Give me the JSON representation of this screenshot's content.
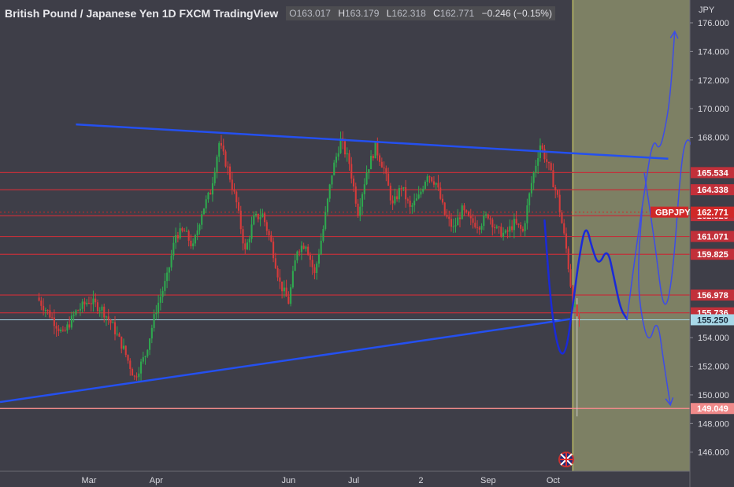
{
  "header": {
    "title": "British Pound / Japanese Yen  1D  FXCM  TradingView",
    "o_label": "O",
    "o": "163.017",
    "h_label": "H",
    "h": "163.179",
    "l_label": "L",
    "l": "162.318",
    "c_label": "C",
    "c": "162.771",
    "change": "−0.246 (−0.15%)"
  },
  "colors": {
    "background": "#3e3e48",
    "future_zone": "#7d8064",
    "up_candle": "#2fa84f",
    "down_candle": "#d63b3b",
    "level_line": "#c2303a",
    "trendline": "#2450f0",
    "drawing": "#3d4ce6",
    "cursor_line": "#e4e46a",
    "support_tag": "#a8d8e8",
    "low_tag": "#f08a8a",
    "symbol_tag": "#d02828"
  },
  "chart_data": {
    "type": "candlestick",
    "symbol": "GBPJPY",
    "currency_label": "JPY",
    "ylim": [
      146,
      178
    ],
    "y_ticks": [
      "176.000",
      "174.000",
      "172.000",
      "170.000",
      "168.000",
      "154.000",
      "152.000",
      "150.000",
      "148.000",
      "146.000"
    ],
    "x_ticks": [
      {
        "label": "Mar",
        "day": 23
      },
      {
        "label": "Apr",
        "day": 54
      },
      {
        "label": "Jun",
        "day": 115
      },
      {
        "label": "Jul",
        "day": 145
      },
      {
        "label": "2",
        "day": 176
      },
      {
        "label": "Sep",
        "day": 207
      },
      {
        "label": "Oct",
        "day": 237
      }
    ],
    "x_range": [
      -18,
      300
    ],
    "last_day": 249,
    "future_start_day": 246,
    "levels": [
      {
        "price": 165.534,
        "label": "165.534"
      },
      {
        "price": 164.338,
        "label": "164.338"
      },
      {
        "price": 162.526,
        "label": "162.526"
      },
      {
        "price": 161.071,
        "label": "161.071"
      },
      {
        "price": 159.825,
        "label": "159.825"
      },
      {
        "price": 156.978,
        "label": "156.978"
      },
      {
        "price": 155.736,
        "label": "155.736"
      }
    ],
    "current_price": {
      "price": 162.771,
      "label": "162.771",
      "symbol": "GBPJPY"
    },
    "support_price": {
      "price": 155.25,
      "label": "155.250"
    },
    "low_price": {
      "price": 149.049,
      "label": "149.049"
    },
    "trendlines": [
      {
        "from": [
          17,
          168.9
        ],
        "to": [
          290,
          166.5
        ]
      },
      {
        "from": [
          -18,
          149.5
        ],
        "to": [
          245,
          155.3
        ]
      }
    ],
    "price_path": [
      [
        0,
        156.8
      ],
      [
        6,
        155.6
      ],
      [
        12,
        154.2
      ],
      [
        18,
        155.8
      ],
      [
        24,
        156.6
      ],
      [
        30,
        156.0
      ],
      [
        35,
        154.8
      ],
      [
        40,
        153.2
      ],
      [
        45,
        151.2
      ],
      [
        50,
        152.8
      ],
      [
        55,
        156.0
      ],
      [
        60,
        158.2
      ],
      [
        64,
        161.2
      ],
      [
        68,
        161.4
      ],
      [
        72,
        160.3
      ],
      [
        76,
        162.8
      ],
      [
        80,
        164.2
      ],
      [
        84,
        167.6
      ],
      [
        88,
        165.8
      ],
      [
        92,
        163.4
      ],
      [
        96,
        160.0
      ],
      [
        100,
        162.3
      ],
      [
        104,
        162.6
      ],
      [
        108,
        160.6
      ],
      [
        112,
        157.8
      ],
      [
        116,
        156.5
      ],
      [
        120,
        160.2
      ],
      [
        124,
        160.6
      ],
      [
        128,
        158.4
      ],
      [
        132,
        161.6
      ],
      [
        136,
        165.5
      ],
      [
        140,
        167.8
      ],
      [
        144,
        166.2
      ],
      [
        148,
        162.8
      ],
      [
        152,
        165.6
      ],
      [
        156,
        167.3
      ],
      [
        160,
        165.8
      ],
      [
        164,
        163.2
      ],
      [
        168,
        164.6
      ],
      [
        172,
        163.0
      ],
      [
        176,
        163.8
      ],
      [
        180,
        165.5
      ],
      [
        184,
        164.8
      ],
      [
        188,
        162.6
      ],
      [
        192,
        161.6
      ],
      [
        196,
        162.9
      ],
      [
        200,
        162.1
      ],
      [
        204,
        161.9
      ],
      [
        208,
        162.6
      ],
      [
        212,
        161.5
      ],
      [
        216,
        161.2
      ],
      [
        220,
        162.0
      ],
      [
        224,
        161.4
      ],
      [
        228,
        164.8
      ],
      [
        232,
        167.5
      ],
      [
        236,
        165.9
      ],
      [
        240,
        163.8
      ],
      [
        244,
        160.2
      ],
      [
        247,
        156.5
      ],
      [
        250,
        155.0
      ],
      [
        253,
        158.2
      ],
      [
        256,
        162.0
      ],
      [
        259,
        165.2
      ],
      [
        262,
        163.6
      ],
      [
        265,
        161.6
      ],
      [
        268,
        160.9
      ],
      [
        271,
        162.9
      ],
      [
        274,
        162.771
      ]
    ]
  },
  "drawings": {
    "blue_path": [
      [
        233,
        162.2
      ],
      [
        235,
        158.0
      ],
      [
        237,
        155.0
      ],
      [
        240,
        152.8
      ],
      [
        243,
        153.0
      ],
      [
        246,
        156.2
      ],
      [
        249,
        159.7
      ],
      [
        252,
        162.0
      ],
      [
        255,
        160.2
      ],
      [
        258,
        159.0
      ],
      [
        262,
        160.3
      ],
      [
        265,
        158.2
      ],
      [
        268,
        156.0
      ],
      [
        271,
        155.3
      ]
    ],
    "arrow_up_1": [
      [
        271,
        155.3
      ],
      [
        275,
        160.0
      ],
      [
        279,
        164.2
      ],
      [
        283,
        168.0
      ],
      [
        286,
        167.0
      ],
      [
        289,
        168.9
      ],
      [
        291,
        171.0
      ],
      [
        293,
        175.4
      ]
    ],
    "arrow_up_2": [
      [
        279,
        165.5
      ],
      [
        284,
        160.5
      ],
      [
        288,
        155.5
      ],
      [
        292,
        158.0
      ],
      [
        296,
        166.5
      ],
      [
        299,
        168.2
      ],
      [
        302,
        166.8
      ],
      [
        306,
        170.5
      ],
      [
        312,
        176.8
      ]
    ],
    "arrow_down": [
      [
        278,
        163.0
      ],
      [
        276,
        159.0
      ],
      [
        277,
        156.0
      ],
      [
        281,
        153.4
      ],
      [
        285,
        155.5
      ],
      [
        288,
        152.2
      ],
      [
        291,
        149.3
      ]
    ]
  }
}
